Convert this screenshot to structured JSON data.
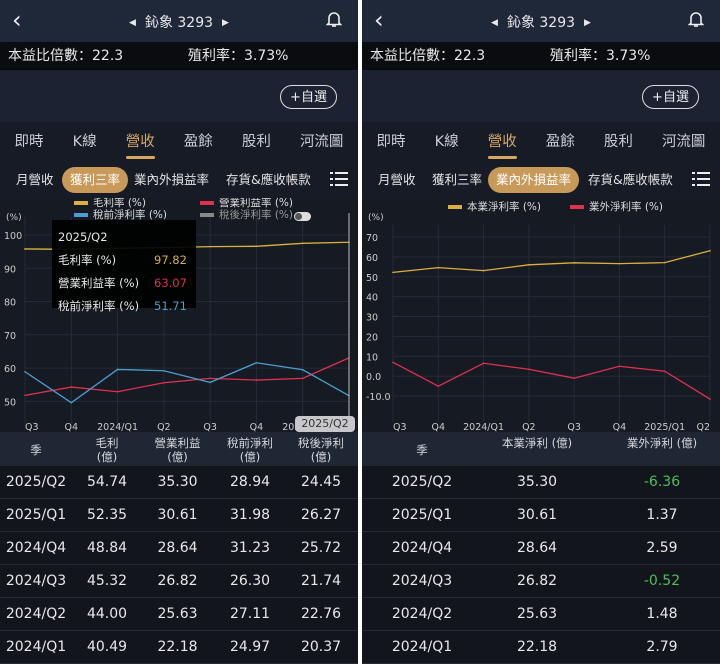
{
  "header": {
    "stock": "鈊象 3293"
  },
  "info": {
    "pe": "本益比倍數：22.3",
    "yield": "殖利率：3.73%"
  },
  "fav_button": "+自選",
  "tabs": [
    "即時",
    "K線",
    "營收",
    "盈餘",
    "股利",
    "河流圖"
  ],
  "subtabs": [
    "月營收",
    "獲利三率",
    "業內外損益率",
    "存貨&應收帳款"
  ],
  "colors": {
    "gold": "#d9b040",
    "red": "#e0304f",
    "blue": "#4a9fd0",
    "grey": "#9a9a9a",
    "accent": "#d9a860",
    "negative": "#4cbf5a"
  },
  "left": {
    "legend": [
      "毛利率 (%)",
      "營業利益率 (%)",
      "稅前淨利率 (%)",
      "稅後淨利率 (%)"
    ],
    "tooltip": {
      "period": "2025/Q2",
      "rows": [
        {
          "label": "毛利率 (%)",
          "value": "97.82"
        },
        {
          "label": "營業利益率 (%)",
          "value": "63.07"
        },
        {
          "label": "稅前淨利率 (%)",
          "value": "51.71"
        }
      ]
    },
    "badge": "2025/Q2",
    "table": {
      "headers": [
        "季",
        "毛利\n(億)",
        "營業利益\n(億)",
        "稅前淨利\n(億)",
        "稅後淨利\n(億)"
      ],
      "rows": [
        [
          "2025/Q2",
          "54.74",
          "35.30",
          "28.94",
          "24.45"
        ],
        [
          "2025/Q1",
          "52.35",
          "30.61",
          "31.98",
          "26.27"
        ],
        [
          "2024/Q4",
          "48.84",
          "28.64",
          "31.23",
          "25.72"
        ],
        [
          "2024/Q3",
          "45.32",
          "26.82",
          "26.30",
          "21.74"
        ],
        [
          "2024/Q2",
          "44.00",
          "25.63",
          "27.11",
          "22.76"
        ],
        [
          "2024/Q1",
          "40.49",
          "22.18",
          "24.97",
          "20.37"
        ]
      ]
    }
  },
  "right": {
    "legend": [
      "本業淨利率 (%)",
      "業外淨利率 (%)"
    ],
    "table": {
      "headers": [
        "季",
        "本業淨利 (億)",
        "業外淨利 (億)"
      ],
      "rows": [
        [
          "2025/Q2",
          "35.30",
          "-6.36"
        ],
        [
          "2025/Q1",
          "30.61",
          "1.37"
        ],
        [
          "2024/Q4",
          "28.64",
          "2.59"
        ],
        [
          "2024/Q3",
          "26.82",
          "-0.52"
        ],
        [
          "2024/Q2",
          "25.63",
          "1.48"
        ],
        [
          "2024/Q1",
          "22.18",
          "2.79"
        ]
      ]
    }
  },
  "chart_data": [
    {
      "type": "line",
      "ylabel": "(%)",
      "categories": [
        "Q3",
        "Q4",
        "2024/Q1",
        "Q2",
        "Q3",
        "Q4",
        "2025/Q1",
        "Q2"
      ],
      "yticks": [
        50,
        60,
        70,
        80,
        90,
        100
      ],
      "ylim": [
        45,
        103
      ],
      "series": [
        {
          "name": "毛利率 (%)",
          "color": "#d9b040",
          "values": [
            95.8,
            95.7,
            96.0,
            96.2,
            96.5,
            96.6,
            97.5,
            97.82
          ]
        },
        {
          "name": "營業利益率 (%)",
          "color": "#e0304f",
          "values": [
            51.8,
            54.3,
            52.9,
            55.6,
            56.9,
            56.4,
            56.9,
            63.07
          ]
        },
        {
          "name": "稅前淨利率 (%)",
          "color": "#4a9fd0",
          "values": [
            58.9,
            49.6,
            59.6,
            59.2,
            55.7,
            61.6,
            59.5,
            51.71
          ]
        }
      ]
    },
    {
      "type": "line",
      "ylabel": "(%)",
      "categories": [
        "Q3",
        "Q4",
        "2024/Q1",
        "Q2",
        "Q3",
        "Q4",
        "2025/Q1",
        "Q2"
      ],
      "yticks": [
        "70",
        "60",
        "50",
        "40",
        "30",
        "20",
        "10",
        "0.0",
        "-10.0"
      ],
      "ylim": [
        -19,
        72
      ],
      "series": [
        {
          "name": "本業淨利率 (%)",
          "color": "#d9b040",
          "values": [
            52.2,
            54.6,
            53.1,
            56.0,
            57.0,
            56.6,
            57.1,
            63.1
          ]
        },
        {
          "name": "業外淨利率 (%)",
          "color": "#e0304f",
          "values": [
            7.0,
            -5.0,
            6.5,
            3.5,
            -1.0,
            5.0,
            2.5,
            -11.5
          ]
        }
      ]
    }
  ]
}
